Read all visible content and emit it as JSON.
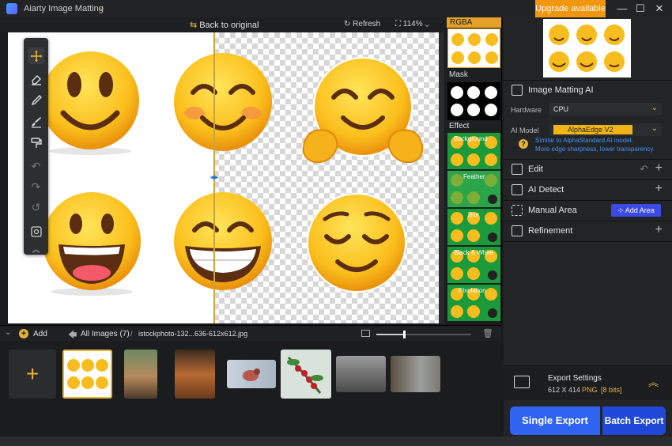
{
  "app": {
    "title": "Aiarty Image Matting",
    "upgrade_label": "Upgrade available"
  },
  "canvas_toolbar": {
    "back_label": "Back to original",
    "refresh_label": "Refresh",
    "zoom": "114%"
  },
  "effects": {
    "rgba_label": "RGBA",
    "mask_label": "Mask",
    "effect_label": "Effect",
    "items": [
      "Background",
      "Feather",
      "Blur",
      "Black & White",
      "Pixelation"
    ]
  },
  "right_panel": {
    "section_title": "Image Matting AI",
    "hardware_label": "Hardware",
    "hardware_value": "CPU",
    "model_label": "AI Model",
    "model_value": "AlphaEdge  V2",
    "hint_line1": "Similar to AlphaStandard AI model.",
    "hint_line2": "More edge sharpness, lower transparency.",
    "edit_label": "Edit",
    "ai_detect_label": "AI Detect",
    "manual_label": "Manual Area",
    "add_area_label": "Add Area",
    "refinement_label": "Refinement",
    "export_settings_label": "Export Settings",
    "export_size": "612 X 414",
    "export_format": "PNG",
    "export_bits": "[8 bits]",
    "single_export": "Single Export",
    "batch_export": "Batch Export"
  },
  "bottom": {
    "add_label": "Add",
    "all_images": "All Images (7)",
    "filename": "istockphoto-132...636-612x612.jpg"
  },
  "colors": {
    "accent": "#e6b33a",
    "export_blue": "#2f63f0",
    "effect_green": "#1a9a3a"
  }
}
